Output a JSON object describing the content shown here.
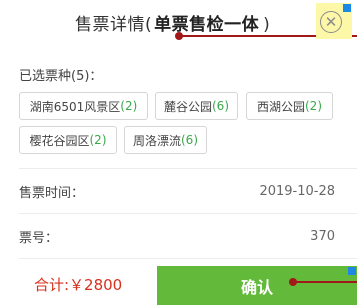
{
  "header": {
    "title_prefix": "售票详情(",
    "mode": "单票售检一体",
    "title_suffix": ")"
  },
  "selection": {
    "label": "已选票种(5)：",
    "chips": [
      {
        "name": "湖南6501风景区",
        "count": "(2)"
      },
      {
        "name": "麓谷公园",
        "count": "(6)"
      },
      {
        "name": "西湖公园",
        "count": "(2)"
      },
      {
        "name": "樱花谷园区",
        "count": "(2)"
      },
      {
        "name": "周洛漂流",
        "count": "(6)"
      }
    ]
  },
  "details": {
    "sale_time_label": "售票时间：",
    "sale_time_value": "2019-10-28",
    "ticket_no_label": "票号：",
    "ticket_no_value": "370"
  },
  "footer": {
    "total": "合计:￥2800",
    "confirm_label": "确认"
  },
  "icons": {
    "close": "close-icon",
    "ad": "ad-badge-icon"
  },
  "colors": {
    "accent_green": "#63b93a",
    "count_green": "#3aa84b",
    "total_red": "#d9301d"
  }
}
